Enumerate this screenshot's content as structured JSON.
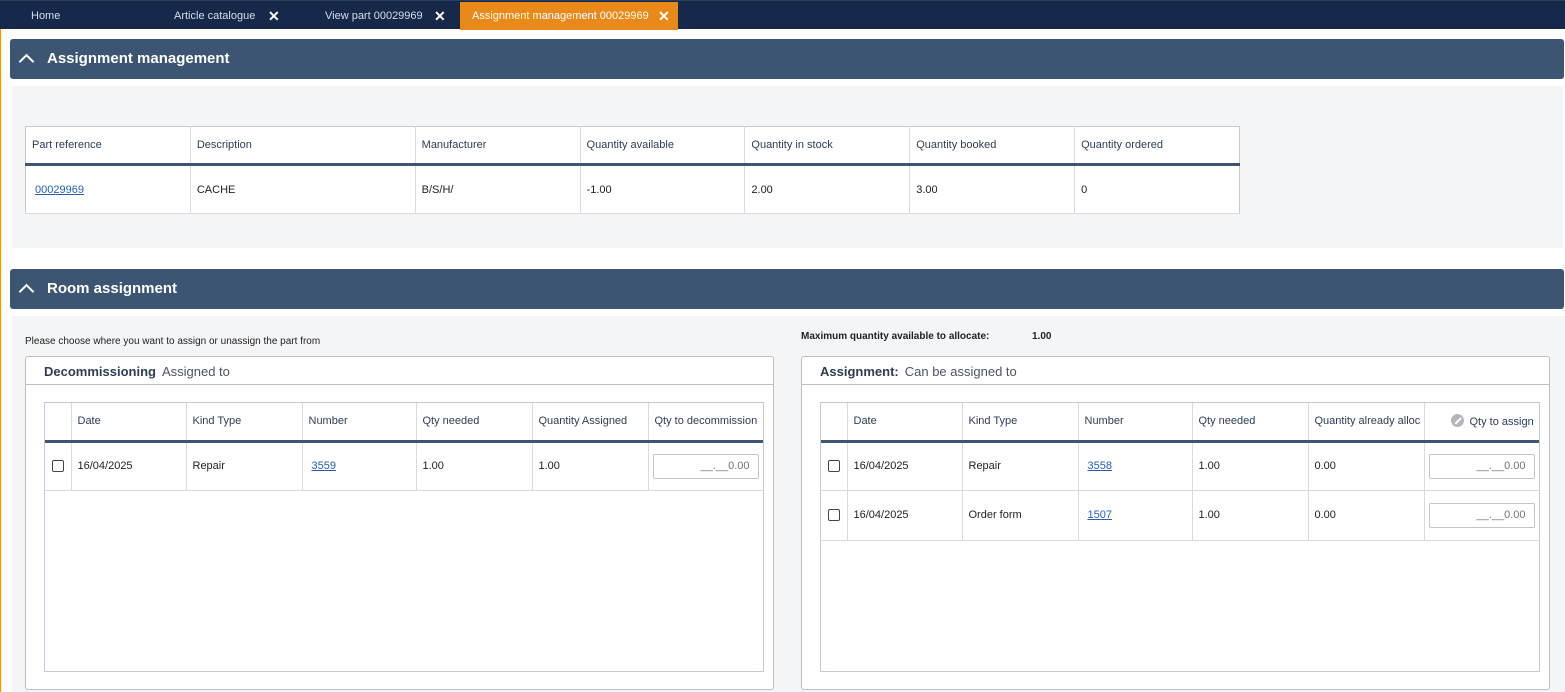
{
  "tabs": [
    {
      "label": "Home",
      "closable": false,
      "active": false
    },
    {
      "label": "Article catalogue",
      "closable": true,
      "active": false
    },
    {
      "label": "View part 00029969",
      "closable": true,
      "active": false
    },
    {
      "label": "Assignment management 00029969",
      "closable": true,
      "active": true
    }
  ],
  "close_glyph": "✕",
  "assignment_management": {
    "title": "Assignment management",
    "columns": [
      "Part reference",
      "Description",
      "Manufacturer",
      "Quantity available",
      "Quantity in stock",
      "Quantity booked",
      "Quantity ordered"
    ],
    "row": {
      "part_reference": "00029969",
      "description": "CACHE",
      "manufacturer": "B/S/H/",
      "quantity_available": "-1.00",
      "quantity_in_stock": "2.00",
      "quantity_booked": "3.00",
      "quantity_ordered": "0"
    }
  },
  "room_assignment": {
    "title": "Room assignment",
    "instruction": "Please choose where you want to assign or unassign the part from",
    "max_label": "Maximum quantity available to allocate:",
    "max_value": "1.00",
    "decommissioning": {
      "title": "Decommissioning",
      "subtitle": "Assigned to",
      "columns": [
        "Date",
        "Kind Type",
        "Number",
        "Qty needed",
        "Quantity Assigned",
        "Qty to decommission"
      ],
      "rows": [
        {
          "date": "16/04/2025",
          "kind": "Repair",
          "number": "3559",
          "qty_needed": "1.00",
          "qty_assigned": "1.00",
          "placeholder": "__.__0.00"
        }
      ]
    },
    "assignment": {
      "title": "Assignment:",
      "subtitle": "Can be assigned to",
      "columns": [
        "Date",
        "Kind Type",
        "Number",
        "Qty needed",
        "Quantity already alloc",
        "Qty to assign"
      ],
      "rows": [
        {
          "date": "16/04/2025",
          "kind": "Repair",
          "number": "3558",
          "qty_needed": "1.00",
          "qty_alloc": "0.00",
          "placeholder": "__.__0.00"
        },
        {
          "date": "16/04/2025",
          "kind": "Order form",
          "number": "1507",
          "qty_needed": "1.00",
          "qty_alloc": "0.00",
          "placeholder": "__.__0.00"
        }
      ]
    }
  },
  "colors": {
    "tabbar": "#16294a",
    "active_tab": "#e8891a",
    "section_header": "#3b5573",
    "link": "#2a5db0"
  }
}
